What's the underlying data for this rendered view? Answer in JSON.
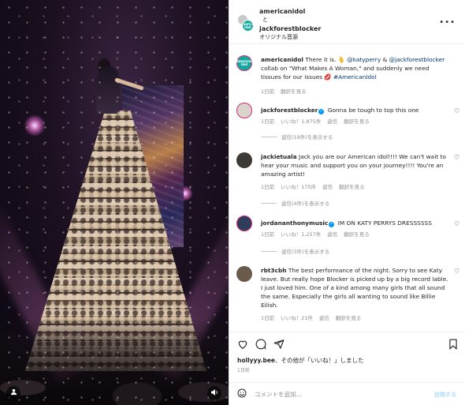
{
  "colors": {
    "accent": "#0095f6",
    "muted": "#8e8e8e",
    "text": "#262626",
    "brand_avatar": "#13a89e"
  },
  "media": {
    "controls": {
      "user_icon": "person-icon",
      "sound_icon": "speaker-icon"
    }
  },
  "header": {
    "user1": "americanidol",
    "connector": "と",
    "user2": "jackforestblocker",
    "audio": "オリジナル音源",
    "avatar_text": "American Idol"
  },
  "caption": {
    "username": "americanidol",
    "text_before": "There it is. 🫰 ",
    "mention1": "@katyperry",
    "text_mid": " & ",
    "mention2": "@jackforestblocker",
    "text_after": " collab on \"What Makes A Woman,\" and suddenly we need tissues for our issues 💋 ",
    "hashtag": "#AmericanIdol",
    "time": "1日前",
    "translate": "翻訳を見る"
  },
  "comments": [
    {
      "username": "jackforestblocker",
      "verified": "✓",
      "text": "Gonna be tough to top this one",
      "time": "1日前",
      "likes": "いいね！1,875件",
      "reply": "返信",
      "translate": "翻訳を見る",
      "replies": "返信(18件)を表示する"
    },
    {
      "username": "jackietuala",
      "text": "Jack you are our American idol!!!! We can't wait to hear your music and support you on your journey!!!! You're an amazing artist!",
      "time": "1日前",
      "likes": "いいね！175件",
      "reply": "返信",
      "translate": "翻訳を見る",
      "replies": "返信(4件)を表示する"
    },
    {
      "username": "jordananthonymusic",
      "verified": "✓",
      "text": "IM ON KATY PERRYS DRESSSSSS",
      "time": "1日前",
      "likes": "いいね！1,257件",
      "reply": "返信",
      "translate": "翻訳を見る",
      "replies": "返信(3件)を表示する"
    },
    {
      "username": "rbt3cbh",
      "text": "The best performance of the night. Sorry to see Katy leave. But really hope Blocker is picked up by a big record lable. I just loved him. One of a kind among many girls that all sound the same. Especially the girls all wanting to sound like Billie Eilish.",
      "time": "1日前",
      "likes": "いいね！21件",
      "reply": "返信",
      "translate": "翻訳を見る"
    }
  ],
  "actions": {
    "like_icon": "heart-icon",
    "comment_icon": "comment-icon",
    "share_icon": "share-icon",
    "save_icon": "bookmark-icon"
  },
  "likes": {
    "user": "hollyyy.bee",
    "text_after_user": "、その他が「いいね！」しました",
    "time": "1日前"
  },
  "add_comment": {
    "placeholder": "コメントを追加...",
    "post_label": "投稿する"
  }
}
